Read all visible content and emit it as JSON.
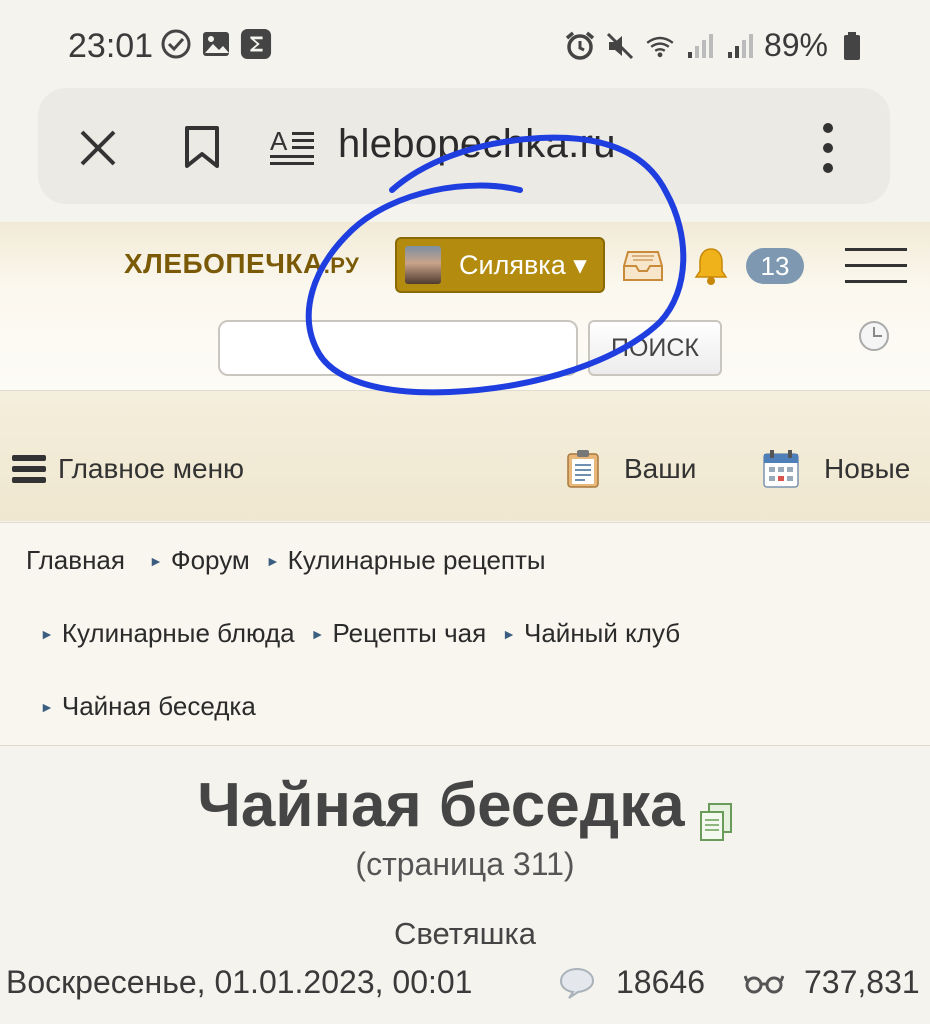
{
  "status_bar": {
    "time": "23:01",
    "battery": "89%"
  },
  "browser": {
    "url": "hlebopechka.ru"
  },
  "header": {
    "logo": "ХЛЕБОПЕЧКА",
    "logo_suffix": ".РУ",
    "username": "Силявка ▾",
    "notifications_count": "13",
    "search_placeholder": "",
    "search_button": "ПОИСК"
  },
  "menu": {
    "main_menu": "Главное меню",
    "yours": "Ваши",
    "new": "Новые"
  },
  "breadcrumbs": [
    "Главная",
    "Форум",
    "Кулинарные рецепты",
    "Кулинарные блюда",
    "Рецепты чая",
    "Чайный клуб",
    "Чайная беседка"
  ],
  "topic": {
    "title": "Чайная беседка",
    "page": "(страница 311)",
    "author": "Светяшка",
    "date": "Воскресенье, 01.01.2023, 00:01",
    "replies": "18646",
    "views": "737,831"
  },
  "colors": {
    "accent": "#b38b0f",
    "logo": "#7a5a07",
    "badge": "#7d98b0",
    "annotation": "#1f3ee0"
  }
}
